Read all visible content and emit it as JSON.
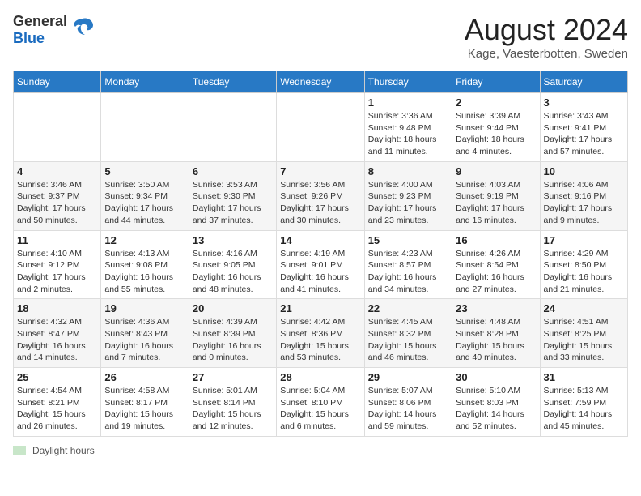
{
  "logo": {
    "general": "General",
    "blue": "Blue"
  },
  "title": "August 2024",
  "subtitle": "Kage, Vaesterbotten, Sweden",
  "days_of_week": [
    "Sunday",
    "Monday",
    "Tuesday",
    "Wednesday",
    "Thursday",
    "Friday",
    "Saturday"
  ],
  "footer": {
    "daylight_label": "Daylight hours"
  },
  "weeks": [
    [
      {
        "day": "",
        "info": ""
      },
      {
        "day": "",
        "info": ""
      },
      {
        "day": "",
        "info": ""
      },
      {
        "day": "",
        "info": ""
      },
      {
        "day": "1",
        "info": "Sunrise: 3:36 AM\nSunset: 9:48 PM\nDaylight: 18 hours\nand 11 minutes."
      },
      {
        "day": "2",
        "info": "Sunrise: 3:39 AM\nSunset: 9:44 PM\nDaylight: 18 hours\nand 4 minutes."
      },
      {
        "day": "3",
        "info": "Sunrise: 3:43 AM\nSunset: 9:41 PM\nDaylight: 17 hours\nand 57 minutes."
      }
    ],
    [
      {
        "day": "4",
        "info": "Sunrise: 3:46 AM\nSunset: 9:37 PM\nDaylight: 17 hours\nand 50 minutes."
      },
      {
        "day": "5",
        "info": "Sunrise: 3:50 AM\nSunset: 9:34 PM\nDaylight: 17 hours\nand 44 minutes."
      },
      {
        "day": "6",
        "info": "Sunrise: 3:53 AM\nSunset: 9:30 PM\nDaylight: 17 hours\nand 37 minutes."
      },
      {
        "day": "7",
        "info": "Sunrise: 3:56 AM\nSunset: 9:26 PM\nDaylight: 17 hours\nand 30 minutes."
      },
      {
        "day": "8",
        "info": "Sunrise: 4:00 AM\nSunset: 9:23 PM\nDaylight: 17 hours\nand 23 minutes."
      },
      {
        "day": "9",
        "info": "Sunrise: 4:03 AM\nSunset: 9:19 PM\nDaylight: 17 hours\nand 16 minutes."
      },
      {
        "day": "10",
        "info": "Sunrise: 4:06 AM\nSunset: 9:16 PM\nDaylight: 17 hours\nand 9 minutes."
      }
    ],
    [
      {
        "day": "11",
        "info": "Sunrise: 4:10 AM\nSunset: 9:12 PM\nDaylight: 17 hours\nand 2 minutes."
      },
      {
        "day": "12",
        "info": "Sunrise: 4:13 AM\nSunset: 9:08 PM\nDaylight: 16 hours\nand 55 minutes."
      },
      {
        "day": "13",
        "info": "Sunrise: 4:16 AM\nSunset: 9:05 PM\nDaylight: 16 hours\nand 48 minutes."
      },
      {
        "day": "14",
        "info": "Sunrise: 4:19 AM\nSunset: 9:01 PM\nDaylight: 16 hours\nand 41 minutes."
      },
      {
        "day": "15",
        "info": "Sunrise: 4:23 AM\nSunset: 8:57 PM\nDaylight: 16 hours\nand 34 minutes."
      },
      {
        "day": "16",
        "info": "Sunrise: 4:26 AM\nSunset: 8:54 PM\nDaylight: 16 hours\nand 27 minutes."
      },
      {
        "day": "17",
        "info": "Sunrise: 4:29 AM\nSunset: 8:50 PM\nDaylight: 16 hours\nand 21 minutes."
      }
    ],
    [
      {
        "day": "18",
        "info": "Sunrise: 4:32 AM\nSunset: 8:47 PM\nDaylight: 16 hours\nand 14 minutes."
      },
      {
        "day": "19",
        "info": "Sunrise: 4:36 AM\nSunset: 8:43 PM\nDaylight: 16 hours\nand 7 minutes."
      },
      {
        "day": "20",
        "info": "Sunrise: 4:39 AM\nSunset: 8:39 PM\nDaylight: 16 hours\nand 0 minutes."
      },
      {
        "day": "21",
        "info": "Sunrise: 4:42 AM\nSunset: 8:36 PM\nDaylight: 15 hours\nand 53 minutes."
      },
      {
        "day": "22",
        "info": "Sunrise: 4:45 AM\nSunset: 8:32 PM\nDaylight: 15 hours\nand 46 minutes."
      },
      {
        "day": "23",
        "info": "Sunrise: 4:48 AM\nSunset: 8:28 PM\nDaylight: 15 hours\nand 40 minutes."
      },
      {
        "day": "24",
        "info": "Sunrise: 4:51 AM\nSunset: 8:25 PM\nDaylight: 15 hours\nand 33 minutes."
      }
    ],
    [
      {
        "day": "25",
        "info": "Sunrise: 4:54 AM\nSunset: 8:21 PM\nDaylight: 15 hours\nand 26 minutes."
      },
      {
        "day": "26",
        "info": "Sunrise: 4:58 AM\nSunset: 8:17 PM\nDaylight: 15 hours\nand 19 minutes."
      },
      {
        "day": "27",
        "info": "Sunrise: 5:01 AM\nSunset: 8:14 PM\nDaylight: 15 hours\nand 12 minutes."
      },
      {
        "day": "28",
        "info": "Sunrise: 5:04 AM\nSunset: 8:10 PM\nDaylight: 15 hours\nand 6 minutes."
      },
      {
        "day": "29",
        "info": "Sunrise: 5:07 AM\nSunset: 8:06 PM\nDaylight: 14 hours\nand 59 minutes."
      },
      {
        "day": "30",
        "info": "Sunrise: 5:10 AM\nSunset: 8:03 PM\nDaylight: 14 hours\nand 52 minutes."
      },
      {
        "day": "31",
        "info": "Sunrise: 5:13 AM\nSunset: 7:59 PM\nDaylight: 14 hours\nand 45 minutes."
      }
    ]
  ]
}
